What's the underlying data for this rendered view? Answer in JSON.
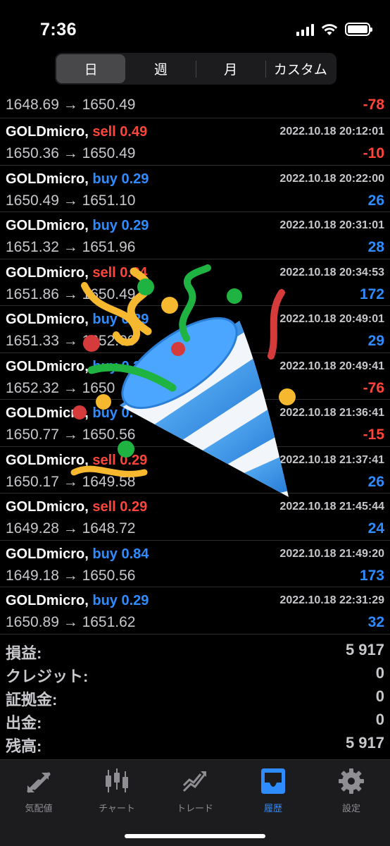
{
  "status_bar": {
    "time": "7:36"
  },
  "segments": [
    {
      "label": "日",
      "active": true
    },
    {
      "label": "週",
      "active": false
    },
    {
      "label": "月",
      "active": false
    },
    {
      "label": "カスタム",
      "active": false
    }
  ],
  "partial_row": {
    "prices": "1648.69 → 1650.49",
    "profit": "-78"
  },
  "trades": [
    {
      "symbol": "GOLDmicro,",
      "side": "sell",
      "volume": "sell 0.49",
      "date": "2022.10.18 20:12:01",
      "prices": "1650.36 → 1650.49",
      "profit": "-10"
    },
    {
      "symbol": "GOLDmicro,",
      "side": "buy",
      "volume": "buy 0.29",
      "date": "2022.10.18 20:22:00",
      "prices": "1650.49 → 1651.10",
      "profit": "26"
    },
    {
      "symbol": "GOLDmicro,",
      "side": "buy",
      "volume": "buy 0.29",
      "date": "2022.10.18 20:31:01",
      "prices": "1651.32 → 1651.96",
      "profit": "28"
    },
    {
      "symbol": "GOLDmicro,",
      "side": "sell",
      "volume": "sell 0.84",
      "date": "2022.10.18 20:34:53",
      "prices": "1651.86 → 1650.49",
      "profit": "172"
    },
    {
      "symbol": "GOLDmicro,",
      "side": "buy",
      "volume": "buy 0.29",
      "date": "2022.10.18 20:49:01",
      "prices": "1651.33 → 1652.00",
      "profit": "29"
    },
    {
      "symbol": "GOLDmicro,",
      "side": "buy",
      "volume": "buy 0.29",
      "date": "2022.10.18 20:49:41",
      "prices": "1652.32 → 1650",
      "profit": "-76"
    },
    {
      "symbol": "GOLDmicro,",
      "side": "buy",
      "volume": "buy 0.",
      "date": "2022.10.18 21:36:41",
      "prices": "1650.77 → 1650.56",
      "profit": "-15"
    },
    {
      "symbol": "GOLDmicro,",
      "side": "sell",
      "volume": "sell 0.29",
      "date": "2022.10.18 21:37:41",
      "prices": "1650.17 → 1649.58",
      "profit": "26"
    },
    {
      "symbol": "GOLDmicro,",
      "side": "sell",
      "volume": "sell 0.29",
      "date": "2022.10.18 21:45:44",
      "prices": "1649.28 → 1648.72",
      "profit": "24"
    },
    {
      "symbol": "GOLDmicro,",
      "side": "buy",
      "volume": "buy 0.84",
      "date": "2022.10.18 21:49:20",
      "prices": "1649.18 → 1650.56",
      "profit": "173"
    },
    {
      "symbol": "GOLDmicro,",
      "side": "buy",
      "volume": "buy 0.29",
      "date": "2022.10.18 22:31:29",
      "prices": "1650.89 → 1651.62",
      "profit": "32"
    }
  ],
  "summary": [
    {
      "label": "損益:",
      "value": "5 917"
    },
    {
      "label": "クレジット:",
      "value": "0"
    },
    {
      "label": "証拠金:",
      "value": "0"
    },
    {
      "label": "出金:",
      "value": "0"
    },
    {
      "label": "残高:",
      "value": "5 917"
    }
  ],
  "tabs": [
    {
      "label": "気配値",
      "icon": "quotes-icon",
      "active": false
    },
    {
      "label": "チャート",
      "icon": "chart-icon",
      "active": false
    },
    {
      "label": "トレード",
      "icon": "trade-icon",
      "active": false
    },
    {
      "label": "履歴",
      "icon": "history-inbox-icon",
      "active": true
    },
    {
      "label": "設定",
      "icon": "gear-icon",
      "active": false
    }
  ],
  "overlay": {
    "emoji": "party-popper-icon"
  },
  "colors": {
    "sell": "#ff453a",
    "buy": "#2f8cff",
    "background": "#000000",
    "accent": "#2f8cff"
  }
}
